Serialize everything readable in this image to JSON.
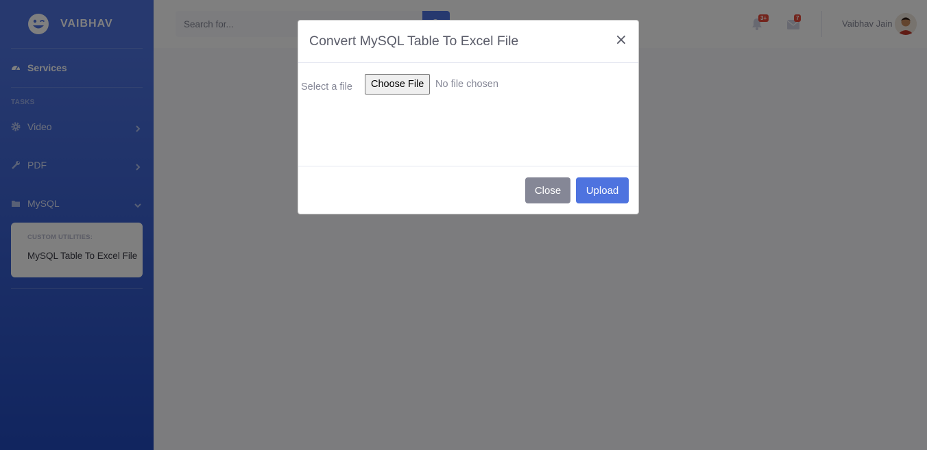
{
  "brand": {
    "name": "VAIBHAV",
    "icon": "laugh-wink-icon"
  },
  "sidebar": {
    "services": {
      "label": "Services",
      "icon": "tachometer-icon"
    },
    "heading": "TASKS",
    "items": [
      {
        "label": "Video",
        "icon": "cog-icon",
        "arrow": "chevron-right-icon"
      },
      {
        "label": "PDF",
        "icon": "wrench-icon",
        "arrow": "chevron-right-icon"
      },
      {
        "label": "MySQL",
        "icon": "folder-icon",
        "arrow": "chevron-down-icon"
      }
    ],
    "collapse": {
      "header": "CUSTOM UTILITIES:",
      "items": [
        "MySQL Table To Excel File"
      ]
    }
  },
  "topbar": {
    "search_placeholder": "Search for...",
    "alerts_badge": "3+",
    "messages_badge": "7",
    "user_name": "Vaibhav Jain"
  },
  "modal": {
    "title": "Convert MySQL Table To Excel File",
    "close_symbol": "×",
    "file_label": "Select a file",
    "choose_button": "Choose File",
    "file_status": "No file chosen",
    "close_button": "Close",
    "upload_button": "Upload"
  },
  "colors": {
    "primary": "#4e73df",
    "secondary": "#858796",
    "danger": "#e74a3b"
  }
}
